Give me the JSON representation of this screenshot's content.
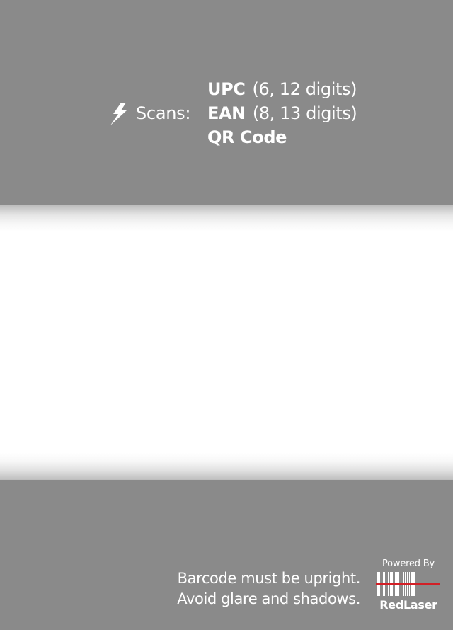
{
  "scans": {
    "label": "Scans:",
    "icon": "lightning-bolt-icon",
    "formats": [
      {
        "name": "UPC",
        "detail": "(6, 12 digits)"
      },
      {
        "name": "EAN",
        "detail": "(8, 13 digits)"
      },
      {
        "name": "QR Code",
        "detail": ""
      }
    ]
  },
  "hints": [
    "Barcode must be upright.",
    "Avoid glare and shadows."
  ],
  "badge": {
    "powered_by": "Powered By",
    "brand": "RedLaser",
    "icon": "barcode-icon",
    "laser_color": "#d21f26"
  },
  "colors": {
    "overlay": "#8a8a8a",
    "scan_area": "#ffffff"
  }
}
